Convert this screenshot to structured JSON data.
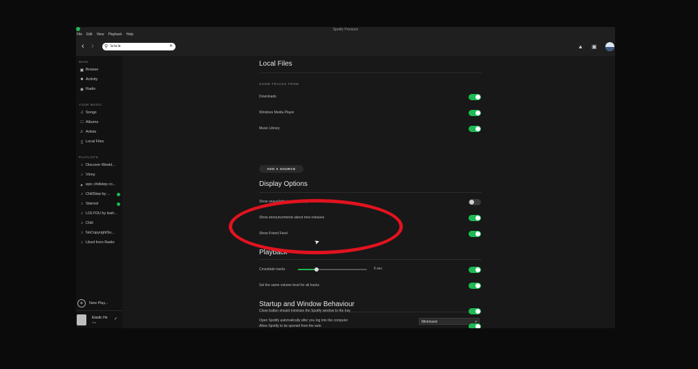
{
  "app": {
    "title": "Spotify Premium"
  },
  "menubar": {
    "items": [
      "File",
      "Edit",
      "View",
      "Playback",
      "Help"
    ]
  },
  "topbar": {
    "back_icon": "chevron-left-icon",
    "forward_icon": "chevron-right-icon",
    "search_value": "la la la",
    "search_icon": "search-icon",
    "clear_icon": "close-icon",
    "bell_icon": "bell-icon",
    "inbox_icon": "inbox-icon"
  },
  "sidebar": {
    "main_header": "MAIN",
    "main_items": [
      {
        "icon": "browse-icon",
        "label": "Browse"
      },
      {
        "icon": "activity-icon",
        "label": "Activity"
      },
      {
        "icon": "radio-icon",
        "label": "Radio"
      }
    ],
    "yourmusic_header": "YOUR MUSIC",
    "yourmusic_items": [
      {
        "icon": "speaker-icon",
        "label": "Songs"
      },
      {
        "icon": "album-icon",
        "label": "Albums"
      },
      {
        "icon": "artist-icon",
        "label": "Artists"
      },
      {
        "icon": "file-icon",
        "label": "Local Files"
      }
    ],
    "playlists_header": "PLAYLISTS",
    "playlists": [
      {
        "label": "Discover Weekl...",
        "badge": false
      },
      {
        "label": "Vinny",
        "badge": false
      },
      {
        "label": "epic chillstep co...",
        "badge": false
      },
      {
        "label": "ChillStep by ...",
        "badge": true
      },
      {
        "label": "Starred",
        "badge": true
      },
      {
        "label": "LOLYOU by leah...",
        "badge": false
      },
      {
        "label": "Chill",
        "badge": false
      },
      {
        "label": "NoCopyrightSo...",
        "badge": false
      },
      {
        "label": "Liked from Radio",
        "badge": false
      }
    ],
    "new_playlist": "New Play...",
    "user_name": "Elastic He",
    "user_sub": "Sw"
  },
  "settings": {
    "local_files": {
      "heading": "Local Files",
      "subheading": "SHOW TRACKS FROM",
      "sources": [
        {
          "label": "Downloads",
          "on": true
        },
        {
          "label": "Windows Media Player",
          "on": true
        },
        {
          "label": "Music Library",
          "on": true
        }
      ],
      "add_source": "ADD A SOURCE"
    },
    "display": {
      "heading": "Display Options",
      "options": [
        {
          "label": "Show unavailable tracks in playlists",
          "on": false
        },
        {
          "label": "Show announcements about new releases",
          "on": true
        },
        {
          "label": "Show Friend Feed",
          "on": true
        }
      ]
    },
    "playback": {
      "heading": "Playback",
      "crossfade_label": "Crossfade tracks",
      "crossfade_value": "5 sec",
      "crossfade_fraction": 0.27,
      "crossfade_on": true,
      "normalize_label": "Set the same volume level for all tracks",
      "normalize_on": true
    },
    "startup": {
      "heading": "Startup and Window Behaviour",
      "autostart_label": "Open Spotify automatically after you log into the computer",
      "autostart_value": "Minimized",
      "close_label": "Close button should minimize the Spotify window to the tray",
      "close_on": true,
      "move_label": "Allow Spotify to be opened from the web",
      "move_on": true
    }
  },
  "colors": {
    "accent": "#1db954",
    "annotation": "#e1131f",
    "background": "#181818",
    "sidebar": "#121212"
  }
}
